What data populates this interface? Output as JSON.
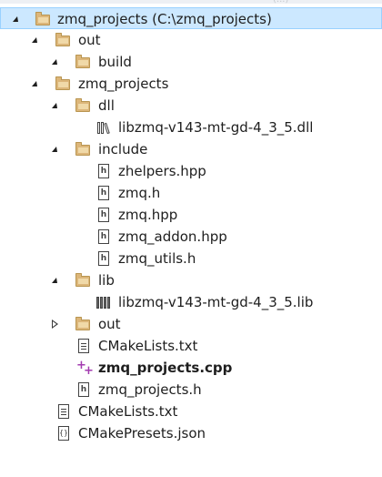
{
  "header": {
    "faded_text": "(...)"
  },
  "tree": [
    {
      "label": "zmq_projects (C:\\zmq_projects)",
      "icon": "folder-icon",
      "expanded": true,
      "selected": true
    },
    {
      "label": "out",
      "icon": "folder-icon",
      "expanded": true
    },
    {
      "label": "build",
      "icon": "folder-icon",
      "expanded": false
    },
    {
      "label": "zmq_projects",
      "icon": "folder-icon",
      "expanded": true
    },
    {
      "label": "dll",
      "icon": "folder-icon",
      "expanded": true
    },
    {
      "label": "libzmq-v143-mt-gd-4_3_5.dll",
      "icon": "library-icon"
    },
    {
      "label": "include",
      "icon": "folder-icon",
      "expanded": true
    },
    {
      "label": "zhelpers.hpp",
      "icon": "header-file-icon"
    },
    {
      "label": "zmq.h",
      "icon": "header-file-icon"
    },
    {
      "label": "zmq.hpp",
      "icon": "header-file-icon"
    },
    {
      "label": "zmq_addon.hpp",
      "icon": "header-file-icon"
    },
    {
      "label": "zmq_utils.h",
      "icon": "header-file-icon"
    },
    {
      "label": "lib",
      "icon": "folder-icon",
      "expanded": true
    },
    {
      "label": "libzmq-v143-mt-gd-4_3_5.lib",
      "icon": "library-icon"
    },
    {
      "label": "out",
      "icon": "folder-icon",
      "expanded": false
    },
    {
      "label": "CMakeLists.txt",
      "icon": "text-file-icon"
    },
    {
      "label": "zmq_projects.cpp",
      "icon": "cpp-file-icon",
      "bold": true
    },
    {
      "label": "zmq_projects.h",
      "icon": "header-file-icon"
    },
    {
      "label": "CMakeLists.txt",
      "icon": "text-file-icon"
    },
    {
      "label": "CMakePresets.json",
      "icon": "json-file-icon"
    }
  ],
  "colors": {
    "selection_bg": "#cce8ff",
    "selection_border": "#99d1ff",
    "folder": "#dcb67a",
    "cpp_accent": "#a33bb0"
  }
}
